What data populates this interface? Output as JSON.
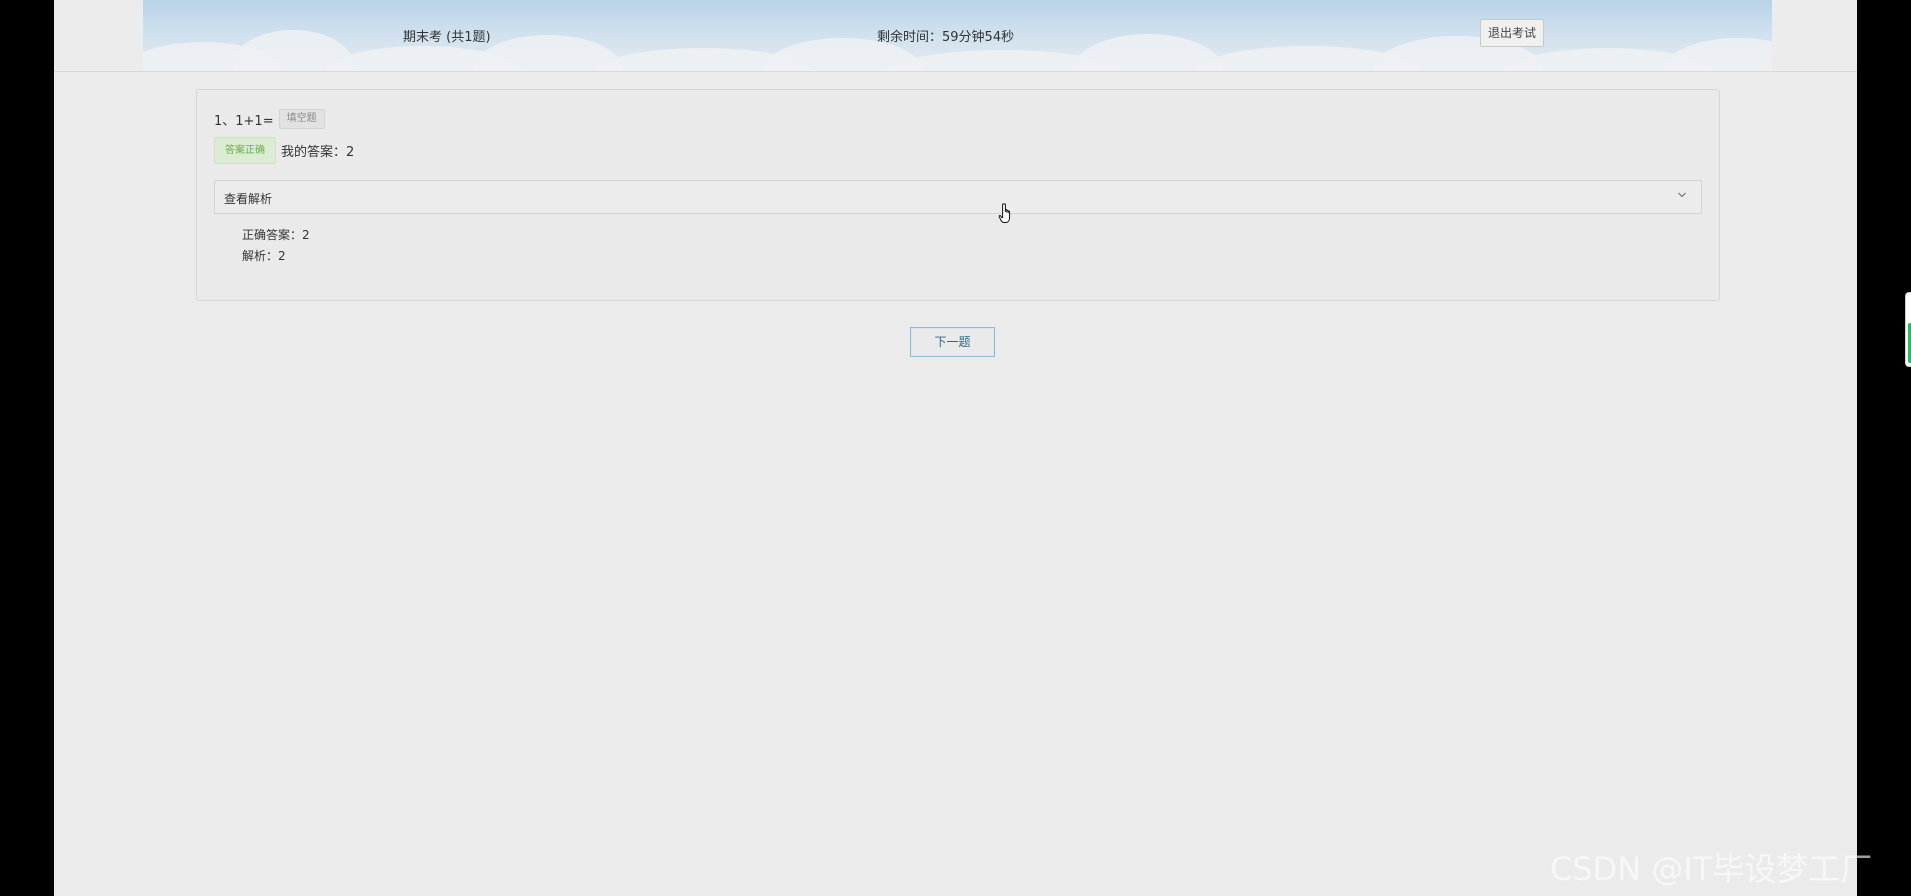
{
  "header": {
    "exam_title": "期末考 (共1题)",
    "timer_text": "剩余时间：59分钟54秒",
    "exit_label": "退出考试"
  },
  "question": {
    "stem": "1、1+1=",
    "type_tag": "填空题",
    "result_tag": "答案正确",
    "my_answer": "我的答案：2",
    "analysis_toggle_label": "查看解析",
    "correct_answer": "正确答案：2",
    "analysis": "解析：2"
  },
  "footer": {
    "next_label": "下一题"
  },
  "watermark": "CSDN @IT毕设梦工厂",
  "colors": {
    "correct_green": "#69b04a",
    "next_border": "#8bbcd0",
    "page_bg": "#ebebeb"
  },
  "icons": {
    "analysis_toggle": "chevron-down-icon",
    "cursor": "hand-pointer-icon"
  }
}
